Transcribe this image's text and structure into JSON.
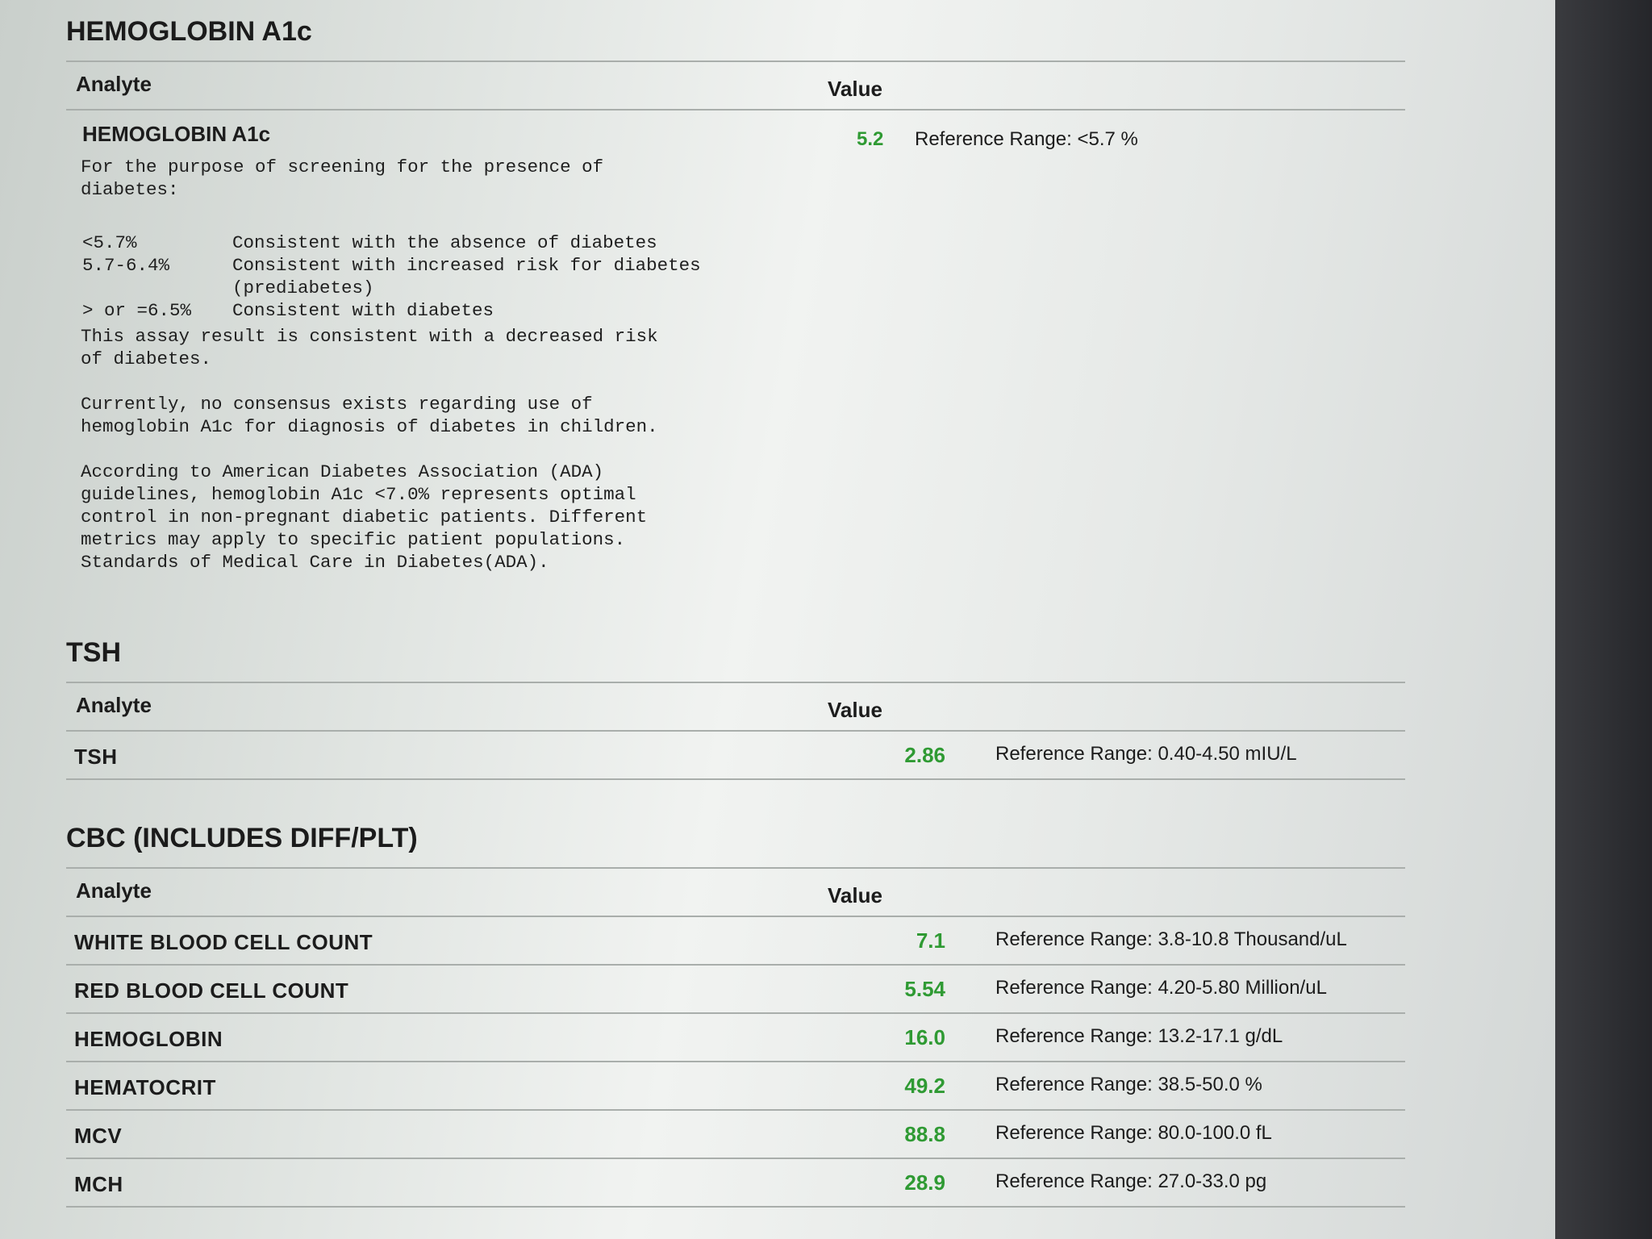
{
  "a1c": {
    "title": "HEMOGLOBIN A1c",
    "analyte_header": "Analyte",
    "value_header": "Value",
    "name": "HEMOGLOBIN A1c",
    "value": "5.2",
    "reference": "Reference Range: <5.7 %",
    "note_intro": "For the purpose of screening for the presence of\ndiabetes:",
    "ranges": [
      {
        "key": "<5.7%",
        "text": "Consistent with the absence of diabetes"
      },
      {
        "key": "5.7-6.4%",
        "text": "Consistent with increased risk for diabetes"
      },
      {
        "key": "",
        "text": "(prediabetes)"
      },
      {
        "key": "> or =6.5%",
        "text": "Consistent with diabetes"
      }
    ],
    "note_assay": "This assay result is consistent with a decreased risk\nof diabetes.",
    "note_children": "Currently, no consensus exists regarding use of\nhemoglobin A1c for diagnosis of diabetes in children.",
    "note_ada": "According to American Diabetes Association (ADA)\nguidelines, hemoglobin A1c <7.0% represents optimal\ncontrol in non-pregnant diabetic patients. Different\nmetrics may apply to specific patient populations.\nStandards of Medical Care in Diabetes(ADA)."
  },
  "tsh": {
    "title": "TSH",
    "analyte_header": "Analyte",
    "value_header": "Value",
    "rows": [
      {
        "name": "TSH",
        "value": "2.86",
        "reference": "Reference Range: 0.40-4.50 mIU/L"
      }
    ]
  },
  "cbc": {
    "title": "CBC (INCLUDES DIFF/PLT)",
    "analyte_header": "Analyte",
    "value_header": "Value",
    "rows": [
      {
        "name": "WHITE BLOOD CELL COUNT",
        "value": "7.1",
        "reference": "Reference Range: 3.8-10.8 Thousand/uL"
      },
      {
        "name": "RED BLOOD CELL COUNT",
        "value": "5.54",
        "reference": "Reference Range: 4.20-5.80 Million/uL"
      },
      {
        "name": "HEMOGLOBIN",
        "value": "16.0",
        "reference": "Reference Range: 13.2-17.1 g/dL"
      },
      {
        "name": "HEMATOCRIT",
        "value": "49.2",
        "reference": "Reference Range: 38.5-50.0 %"
      },
      {
        "name": "MCV",
        "value": "88.8",
        "reference": "Reference Range: 80.0-100.0 fL"
      },
      {
        "name": "MCH",
        "value": "28.9",
        "reference": "Reference Range: 27.0-33.0 pg"
      }
    ]
  },
  "colors": {
    "value_green": "#2f9a33",
    "rule_gray": "#a9aeab"
  }
}
